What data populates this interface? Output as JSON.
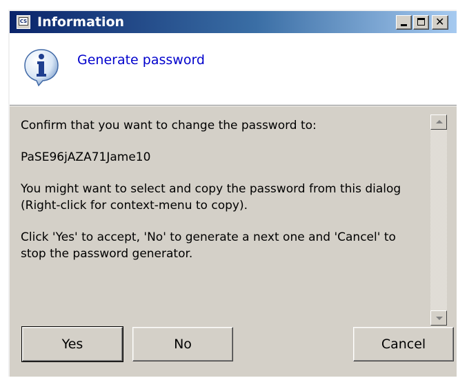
{
  "window": {
    "title": "Information",
    "app_icon_text": "CS"
  },
  "header": {
    "title": "Generate password",
    "icon": "info-icon"
  },
  "message": {
    "line1": "Confirm that you want to change the password to:",
    "password": "PaSE96jAZA71Jame10",
    "line3": "You might want to select and copy the password from this dialog (Right-click for context-menu to copy).",
    "line4": "Click 'Yes' to accept, 'No' to generate a next one and 'Cancel' to stop the password generator."
  },
  "buttons": {
    "yes": "Yes",
    "no": "No",
    "cancel": "Cancel"
  },
  "colors": {
    "title_bar_start": "#0a246a",
    "title_bar_end": "#a6caf0",
    "header_text": "#0000cc",
    "face": "#d4d0c8"
  }
}
